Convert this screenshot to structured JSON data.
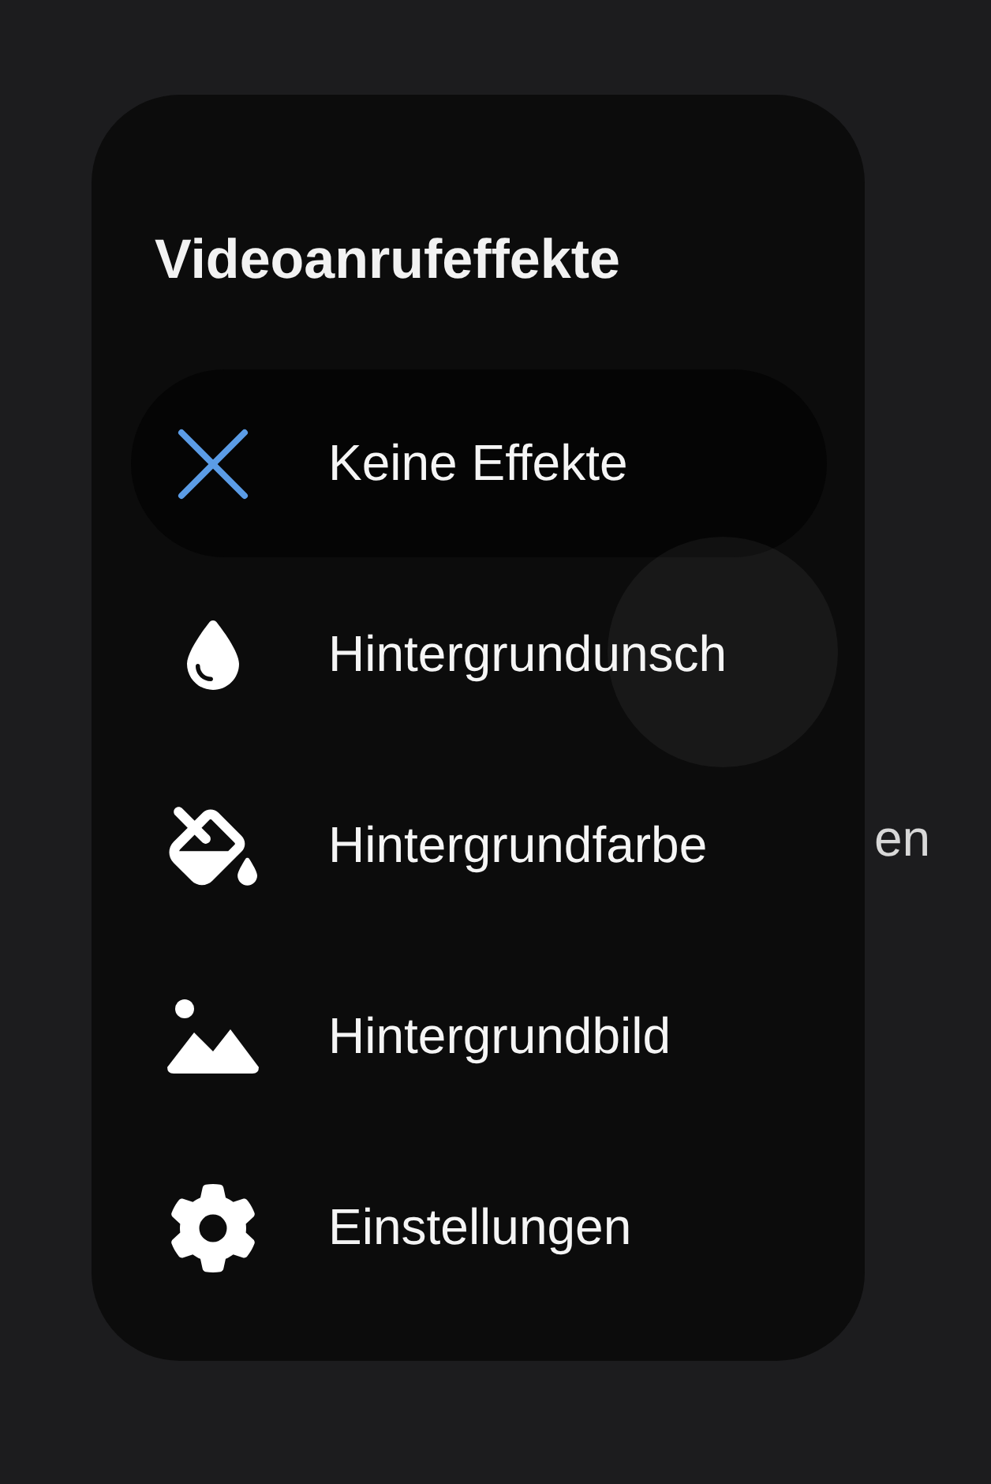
{
  "background_text": "en",
  "panel": {
    "title": "Videoanrufeffekte",
    "items": [
      {
        "kind": "none",
        "label": "Keine Effekte",
        "selected": true
      },
      {
        "kind": "blur",
        "label": "Hintergrundunsch",
        "selected": false
      },
      {
        "kind": "color",
        "label": "Hintergrundfarbe",
        "selected": false
      },
      {
        "kind": "image",
        "label": "Hintergrundbild",
        "selected": false
      },
      {
        "kind": "settings",
        "label": "Einstellungen",
        "selected": false
      }
    ]
  }
}
